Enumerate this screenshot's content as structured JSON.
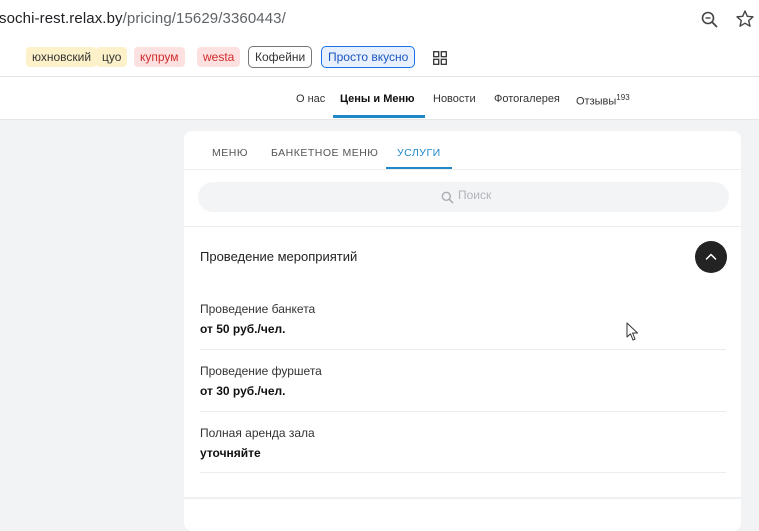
{
  "browser": {
    "url_host": "sochi-rest.relax.by",
    "url_path": "/pricing/15629/3360443/",
    "zoom_icon": "zoom-out-icon",
    "bookmark_icon": "star-icon"
  },
  "bookmarks": [
    {
      "label": "юхновский",
      "style": "yellow"
    },
    {
      "label": "цуо",
      "style": "yellow"
    },
    {
      "label": "купрум",
      "style": "red"
    },
    {
      "label": "westa",
      "style": "red"
    },
    {
      "label": "Кофейни",
      "style": "outline"
    },
    {
      "label": "Просто вкусно",
      "style": "blue"
    }
  ],
  "site_nav": {
    "about": "О нас",
    "prices": "Цены и Меню",
    "news": "Новости",
    "gallery": "Фотогалерея",
    "reviews": "Отзывы",
    "reviews_count": "193"
  },
  "tabs": {
    "menu": "МЕНЮ",
    "banquet": "БАНКЕТНОЕ МЕНЮ",
    "services": "УСЛУГИ",
    "active": "services"
  },
  "search": {
    "placeholder": "Поиск"
  },
  "section": {
    "title": "Проведение мероприятий",
    "items": [
      {
        "name": "Проведение банкета",
        "price": "от 50 руб./чел."
      },
      {
        "name": "Проведение фуршета",
        "price": "от 30 руб./чел."
      },
      {
        "name": "Полная аренда зала",
        "price": "уточняйте"
      }
    ]
  },
  "colors": {
    "accent": "#1e88c9",
    "dark_button": "#232323"
  }
}
